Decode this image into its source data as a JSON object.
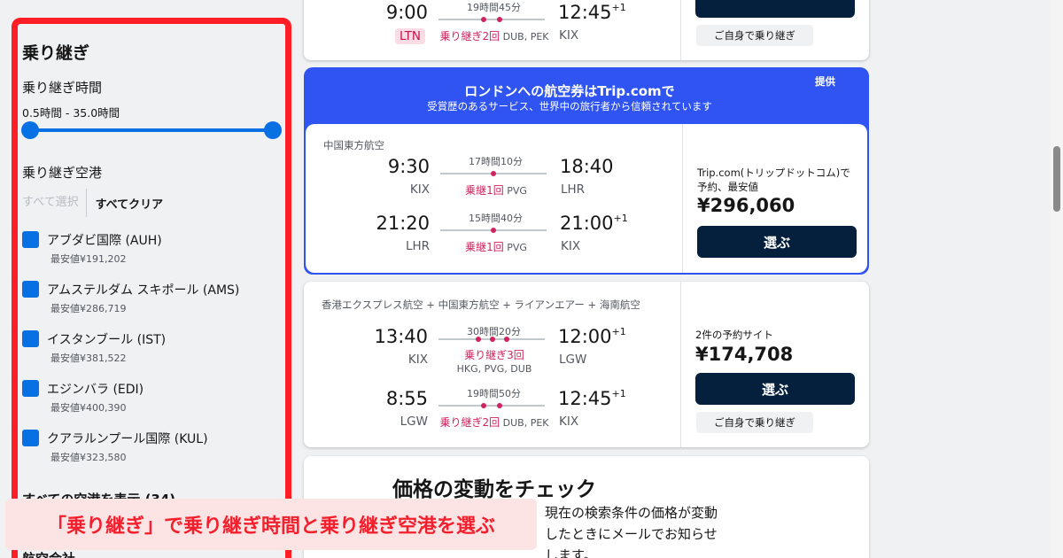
{
  "sidebar": {
    "title": "乗り継ぎ",
    "duration_heading": "乗り継ぎ時間",
    "duration_range": "0.5時間 - 35.0時間",
    "slider_min_hours": 0.5,
    "slider_max_hours": 35.0,
    "airports_heading": "乗り継ぎ空港",
    "select_all": "すべて選択",
    "clear_all": "すべてクリア",
    "airports": [
      {
        "name": "アブダビ国際 (AUH)",
        "price": "最安値¥191,202",
        "checked": true
      },
      {
        "name": "アムステルダム スキポール (AMS)",
        "price": "最安値¥286,719",
        "checked": true
      },
      {
        "name": "イスタンブール (IST)",
        "price": "最安値¥381,522",
        "checked": true
      },
      {
        "name": "エジンバラ (EDI)",
        "price": "最安値¥400,390",
        "checked": true
      },
      {
        "name": "クアラルンプール国際 (KUL)",
        "price": "最安値¥323,580",
        "checked": true
      }
    ],
    "show_all": "すべての空港を表示 (34)",
    "next_section": "航空会社"
  },
  "caption": "「乗り継ぎ」で乗り継ぎ時間と乗り継ぎ空港を選ぶ",
  "top_card": {
    "leg": {
      "dep_time": "9:00",
      "dep_code": "LTN",
      "duration": "19時間45分",
      "stops_label": "乗り継ぎ2回",
      "stops_airports": "DUB, PEK",
      "arr_time": "12:45",
      "arr_offset": "+1",
      "arr_code": "KIX"
    },
    "self_transfer": "ご自身で乗り継ぎ"
  },
  "promo": {
    "headline": "ロンドンへの航空券はTrip.comで",
    "subline": "受賞歴のあるサービス、世界中の旅行者から信頼されています",
    "sponsored": "提供",
    "airline": "中国東方航空",
    "legs": [
      {
        "dep_time": "9:30",
        "dep_code": "KIX",
        "duration": "17時間10分",
        "stops_label": "乗継1回",
        "stops_airports": "PVG",
        "arr_time": "18:40",
        "arr_offset": "",
        "arr_code": "LHR"
      },
      {
        "dep_time": "21:20",
        "dep_code": "LHR",
        "duration": "15時間40分",
        "stops_label": "乗継1回",
        "stops_airports": "PVG",
        "arr_time": "21:00",
        "arr_offset": "+1",
        "arr_code": "KIX"
      }
    ],
    "provider": "Trip.com(トリップドットコム)で予約、最安値",
    "price": "¥296,060",
    "select_label": "選ぶ"
  },
  "card2": {
    "airline": "香港エクスプレス航空 + 中国東方航空 + ライアンエアー + 海南航空",
    "legs": [
      {
        "dep_time": "13:40",
        "dep_code": "KIX",
        "duration": "30時間20分",
        "stops_label": "乗り継ぎ3回",
        "stops_airports": "HKG, PVG, DUB",
        "arr_time": "12:00",
        "arr_offset": "+1",
        "arr_code": "LGW"
      },
      {
        "dep_time": "8:55",
        "dep_code": "LGW",
        "duration": "19時間50分",
        "stops_label": "乗り継ぎ2回",
        "stops_airports": "DUB, PEK",
        "arr_time": "12:45",
        "arr_offset": "+1",
        "arr_code": "KIX"
      }
    ],
    "sites": "2件の予約サイト",
    "price": "¥174,708",
    "select_label": "選ぶ",
    "self_transfer": "ご自身で乗り継ぎ"
  },
  "alert": {
    "title": "価格の変動をチェック",
    "body": "現在の検索条件の価格が変動したときにメールでお知らせします。"
  },
  "colors": {
    "accent": "#0770e3",
    "highlight": "#ff1e26",
    "stop": "#d1235f",
    "button": "#05203c",
    "promo": "#2f54f1"
  }
}
